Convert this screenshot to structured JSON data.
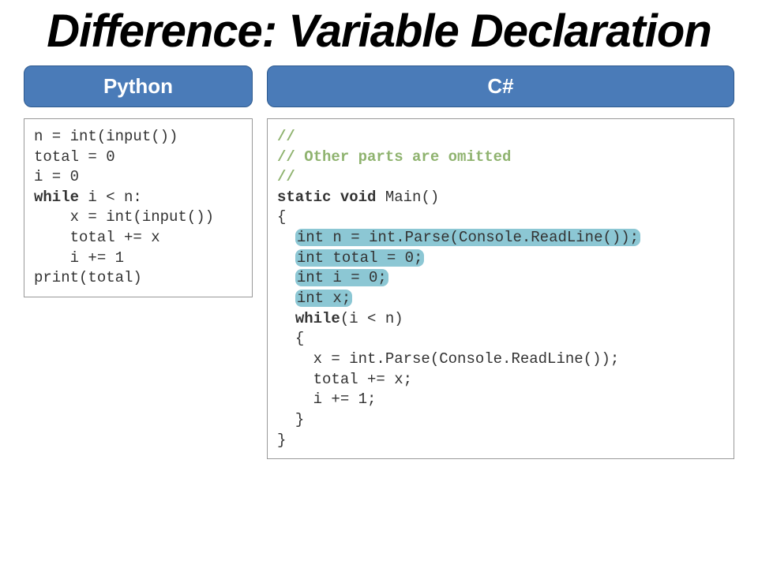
{
  "title": "Difference: Variable Declaration",
  "left": {
    "header": "Python",
    "code": {
      "l1": "n = int(input())",
      "l2": "total = 0",
      "l3": "i = 0",
      "l4a": "while",
      "l4b": " i < n:",
      "l5": "    x = int(input())",
      "l6": "    total += x",
      "l7": "    i += 1",
      "l8": "print(total)"
    }
  },
  "right": {
    "header": "C#",
    "code": {
      "c1": "//",
      "c2": "// Other parts are omitted",
      "c3": "//",
      "kw_static": "static",
      "kw_void": "void",
      "main_sig": " Main()",
      "lbrace": "{",
      "decl1": "int n = int.Parse(Console.ReadLine());",
      "decl2": "int total = 0;",
      "decl3": "int i = 0;",
      "decl4": "int x;",
      "kw_while": "while",
      "while_cond": "(i < n)",
      "lbrace2": "{",
      "body1": "x = int.Parse(Console.ReadLine());",
      "body2": "total += x;",
      "body3": "i += 1;",
      "rbrace2": "}",
      "rbrace": "}"
    }
  }
}
